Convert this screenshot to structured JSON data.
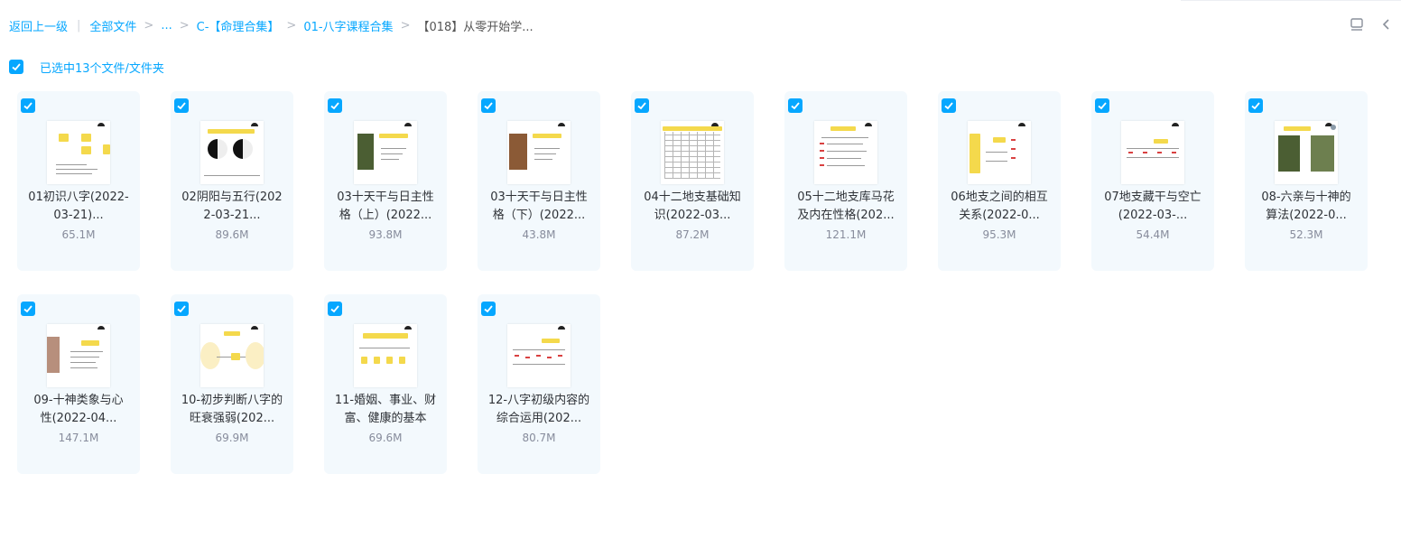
{
  "breadcrumb": {
    "back": "返回上一级",
    "all_files": "全部文件",
    "ellipsis": "...",
    "level1": "C-【命理合集】",
    "level2": "01-八字课程合集",
    "current": "【018】从零开始学..."
  },
  "toolbar": {
    "list_view_icon": "list-view-icon",
    "collapse_icon": "chevron-left-icon"
  },
  "selection": {
    "label": "已选中13个文件/文件夹",
    "checked": true
  },
  "colors": {
    "accent": "#06a7ff",
    "card_bg": "#f3f9fd",
    "thumb_yellow": "#f4d94c",
    "size_text": "#878c9c"
  },
  "files": [
    {
      "name_line1": "01初识八字(2022-",
      "name_line2": "03-21)...",
      "size": "65.1M",
      "thumb": "boxes",
      "checked": true
    },
    {
      "name_line1": "02阴阳与五行(202",
      "name_line2": "2-03-21...",
      "size": "89.6M",
      "thumb": "yinyang",
      "checked": true
    },
    {
      "name_line1": "03十天干与日主性",
      "name_line2": "格（上）(2022...",
      "size": "93.8M",
      "thumb": "photo",
      "checked": true
    },
    {
      "name_line1": "03十天干与日主性",
      "name_line2": "格（下）(2022...",
      "size": "43.8M",
      "thumb": "photo-brown",
      "checked": true
    },
    {
      "name_line1": "04十二地支基础知",
      "name_line2": "识(2022-03...",
      "size": "87.2M",
      "thumb": "table",
      "checked": true
    },
    {
      "name_line1": "05十二地支库马花",
      "name_line2": "及内在性格(202...",
      "size": "121.1M",
      "thumb": "list-red",
      "checked": true
    },
    {
      "name_line1": "06地支之间的相互",
      "name_line2": "关系(2022-0...",
      "size": "95.3M",
      "thumb": "boxes-red",
      "checked": true
    },
    {
      "name_line1": "07地支藏干与空亡",
      "name_line2": "(2022-03-...",
      "size": "54.4M",
      "thumb": "grid-small",
      "checked": true
    },
    {
      "name_line1": "08-六亲与十神的",
      "name_line2": "算法(2022-0...",
      "size": "52.3M",
      "thumb": "photos-two",
      "checked": true
    },
    {
      "name_line1": "09-十神类象与心",
      "name_line2": "性(2022-04...",
      "size": "147.1M",
      "thumb": "photo-left",
      "checked": true
    },
    {
      "name_line1": "10-初步判断八字的",
      "name_line2": "旺衰强弱(202...",
      "size": "69.9M",
      "thumb": "flow",
      "checked": true
    },
    {
      "name_line1": "11-婚姻、事业、财",
      "name_line2": "富、健康的基本",
      "size": "69.6M",
      "thumb": "cards",
      "checked": true
    },
    {
      "name_line1": "12-八字初级内容的",
      "name_line2": "综合运用(202...",
      "size": "80.7M",
      "thumb": "chart-red",
      "checked": true
    }
  ]
}
